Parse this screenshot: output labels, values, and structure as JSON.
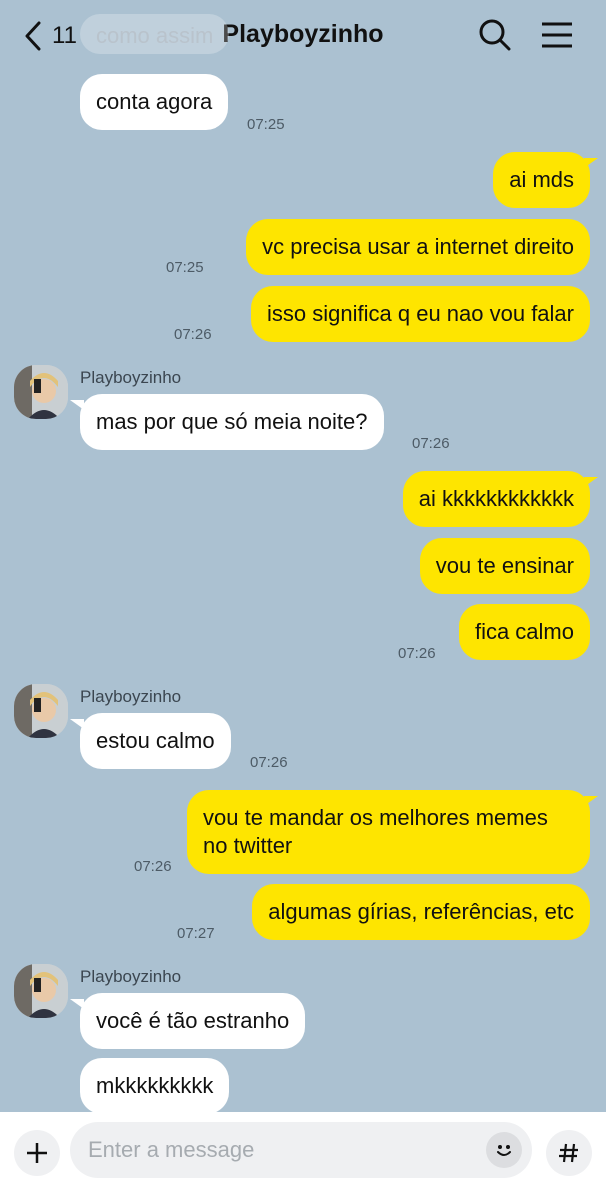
{
  "header": {
    "back_count": "11",
    "title": "Playboyzinho",
    "back_icon": "chevron-left-icon",
    "search_icon": "search-icon",
    "menu_icon": "hamburger-menu-icon"
  },
  "messages": [
    {
      "side": "in",
      "text": "como assim",
      "faded": true
    },
    {
      "side": "in",
      "text": "conta agora",
      "time": "07:25"
    },
    {
      "side": "out",
      "text": "ai mds"
    },
    {
      "side": "out",
      "text": "vc precisa usar a internet direito",
      "time": "07:25"
    },
    {
      "side": "out",
      "text": "isso significa q eu nao vou falar",
      "time": "07:26"
    },
    {
      "side": "in",
      "sender": "Playboyzinho",
      "text": "mas por que só meia noite?",
      "time": "07:26"
    },
    {
      "side": "out",
      "text": "ai kkkkkkkkkkkk"
    },
    {
      "side": "out",
      "text": "vou te ensinar"
    },
    {
      "side": "out",
      "text": "fica calmo",
      "time": "07:26"
    },
    {
      "side": "in",
      "sender": "Playboyzinho",
      "text": "estou calmo",
      "time": "07:26"
    },
    {
      "side": "out",
      "text": "vou te mandar os melhores memes",
      "text2": "no twitter",
      "time": "07:26"
    },
    {
      "side": "out",
      "text": "algumas gírias, referências, etc",
      "time": "07:27"
    },
    {
      "side": "in",
      "sender": "Playboyzinho",
      "text": "você é tão estranho"
    },
    {
      "side": "in",
      "text": "mkkkkkkkkk"
    }
  ],
  "input": {
    "placeholder": "Enter a message",
    "plus_icon": "plus-icon",
    "emoji_icon": "emoji-icon",
    "hash_icon": "hash-icon"
  },
  "colors": {
    "background": "#abc1d1",
    "outgoing_bubble": "#fee500",
    "incoming_bubble": "#ffffff"
  }
}
